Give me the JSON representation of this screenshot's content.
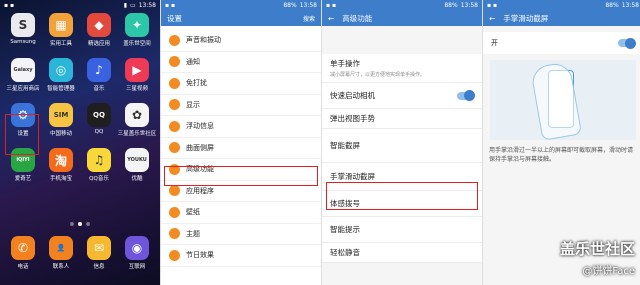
{
  "status": {
    "p1_time": "13:58",
    "p2_battery": "88%",
    "p2_time": "13:58",
    "p3_battery": "88%",
    "p3_time": "13:58",
    "p4_battery": "88%",
    "p4_time": "13:58"
  },
  "home": {
    "apps": [
      {
        "label": "Samsung",
        "glyph": "S",
        "color": "#e9e9ee"
      },
      {
        "label": "实用工具",
        "glyph": "▦",
        "color": "#f2a23a"
      },
      {
        "label": "精选应用",
        "glyph": "◆",
        "color": "#e44a3c"
      },
      {
        "label": "盖乐世空间",
        "glyph": "✦",
        "color": "#2cc7a8"
      },
      {
        "label": "三星应用商店",
        "glyph": "Galaxy",
        "color": "#f4f4f8"
      },
      {
        "label": "智能管理器",
        "glyph": "◎",
        "color": "#2bb6d9"
      },
      {
        "label": "音乐",
        "glyph": "♪",
        "color": "#3a62e0"
      },
      {
        "label": "三星视频",
        "glyph": "▶",
        "color": "#ee3a55"
      },
      {
        "label": "设置",
        "glyph": "⚙",
        "color": "#3b74d8"
      },
      {
        "label": "中国移动",
        "glyph": "SIM",
        "color": "#f4c442"
      },
      {
        "label": "QQ",
        "glyph": "QQ",
        "color": "#1f1f1f"
      },
      {
        "label": "三星盖乐世社区",
        "glyph": "✿",
        "color": "#f4f4f4"
      },
      {
        "label": "爱奇艺",
        "glyph": "iQIYI",
        "color": "#2aa543"
      },
      {
        "label": "手机淘宝",
        "glyph": "淘",
        "color": "#f46b1c"
      },
      {
        "label": "QQ音乐",
        "glyph": "♫",
        "color": "#f7d73a"
      },
      {
        "label": "优酷",
        "glyph": "YOUKU",
        "color": "#f4f4f4"
      }
    ],
    "dock": [
      {
        "label": "电话",
        "glyph": "✆",
        "color": "#f2821f"
      },
      {
        "label": "联系人",
        "glyph": "👤",
        "color": "#f2821f"
      },
      {
        "label": "信息",
        "glyph": "✉",
        "color": "#f5b82e"
      },
      {
        "label": "互联网",
        "glyph": "◉",
        "color": "#6e55d9"
      }
    ]
  },
  "settings": {
    "title": "设置",
    "search": "搜索",
    "items": [
      "声音和振动",
      "通知",
      "免打扰",
      "显示",
      "浮动信息",
      "曲面侧屏",
      "高级功能",
      "应用程序",
      "壁纸",
      "主题",
      "节日效果"
    ]
  },
  "advanced": {
    "title": "高级功能",
    "one_hand": {
      "title": "单手操作",
      "desc": "减小屏幕尺寸，以更方便地实现单手操作。"
    },
    "quick_camera": "快速启动相机",
    "popup": "弹出视图手势",
    "smart_capture": "智能截屏",
    "palm_swipe": "手掌滑动截屏",
    "motion": "体感拨号",
    "smart_alert": "智能提示",
    "mute": "轻松静音"
  },
  "palm": {
    "title": "手掌滑动截屏",
    "on_label": "开",
    "description": "用手掌沿滑过一半以上的屏幕即可截取屏幕，滑动时请保持手掌沿与屏幕接触。"
  },
  "watermark": {
    "line1": "盖乐世社区",
    "line2": "@饼饼Face"
  },
  "colors": {
    "accent": "#3d7dc9",
    "highlight": "#e02020",
    "settings_icon": "#f28b22"
  }
}
